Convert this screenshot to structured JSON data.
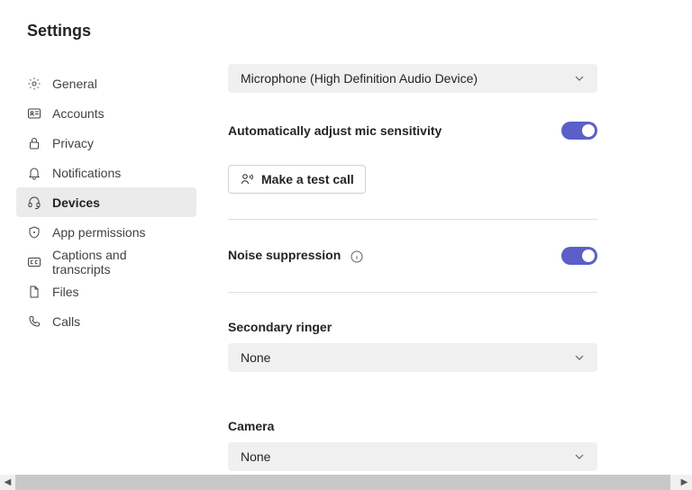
{
  "title": "Settings",
  "sidebar": {
    "items": [
      {
        "label": "General"
      },
      {
        "label": "Accounts"
      },
      {
        "label": "Privacy"
      },
      {
        "label": "Notifications"
      },
      {
        "label": "Devices"
      },
      {
        "label": "App permissions"
      },
      {
        "label": "Captions and transcripts"
      },
      {
        "label": "Files"
      },
      {
        "label": "Calls"
      }
    ]
  },
  "colors": {
    "accent": "#5b5fc7",
    "select_bg": "#f0f0f0",
    "active_bg": "#ebebeb"
  },
  "main": {
    "microphone_select": "Microphone (High Definition Audio Device)",
    "auto_adjust_label": "Automatically adjust mic sensitivity",
    "auto_adjust_on": true,
    "test_call_label": "Make a test call",
    "noise_suppression_label": "Noise suppression",
    "noise_suppression_on": true,
    "secondary_ringer_label": "Secondary ringer",
    "secondary_ringer_value": "None",
    "camera_label": "Camera",
    "camera_value": "None"
  }
}
